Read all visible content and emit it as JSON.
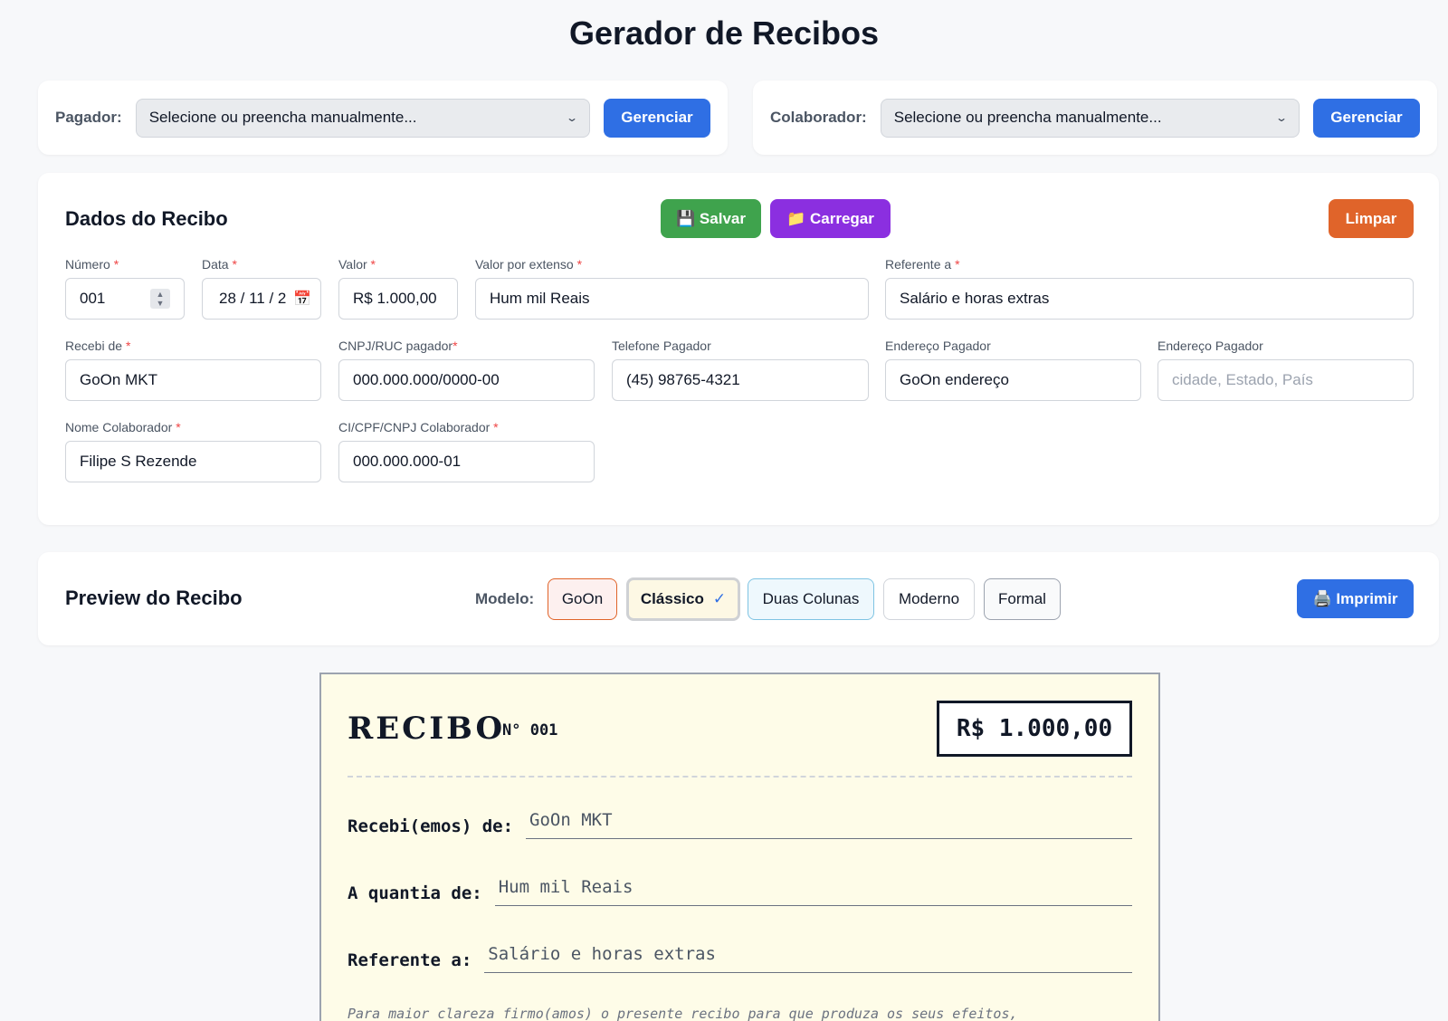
{
  "page_title": "Gerador de Recibos",
  "pagador": {
    "label": "Pagador:",
    "select_value": "Selecione ou preencha manualmente...",
    "button": "Gerenciar"
  },
  "colaborador": {
    "label": "Colaborador:",
    "select_value": "Selecione ou preencha manualmente...",
    "button": "Gerenciar"
  },
  "dados": {
    "title": "Dados do Recibo",
    "save_button": "💾 Salvar",
    "load_button": "📁 Carregar",
    "clear_button": "Limpar",
    "fields": {
      "numero": {
        "label": "Número",
        "value": "001"
      },
      "data": {
        "label": "Data",
        "value": "28 / 11 / 2"
      },
      "valor": {
        "label": "Valor",
        "value": "R$ 1.000,00"
      },
      "extenso": {
        "label": "Valor por extenso",
        "value": "Hum mil Reais"
      },
      "referente": {
        "label": "Referente a",
        "value": "Salário e horas extras"
      },
      "recebi": {
        "label": "Recebi de",
        "value": "GoOn MKT"
      },
      "cnpj_pagador": {
        "label": "CNPJ/RUC pagador",
        "value": "000.000.000/0000-00"
      },
      "telefone": {
        "label": "Telefone Pagador",
        "value": "(45) 98765-4321"
      },
      "endereco1": {
        "label": "Endereço Pagador",
        "value": "GoOn endereço"
      },
      "endereco2": {
        "label": "Endereço Pagador",
        "placeholder": "cidade, Estado, País"
      },
      "nome_colab": {
        "label": "Nome Colaborador",
        "value": "Filipe S Rezende"
      },
      "doc_colab": {
        "label": "CI/CPF/CNPJ Colaborador",
        "value": "000.000.000-01"
      }
    }
  },
  "preview": {
    "title": "Preview do Recibo",
    "model_label": "Modelo:",
    "models": [
      "GoOn",
      "Clássico",
      "Duas Colunas",
      "Moderno",
      "Formal"
    ],
    "selected_model": "Clássico",
    "selected_check": "✓",
    "print_button": "🖨️ Imprimir"
  },
  "receipt": {
    "title": "RECIBO",
    "number": "N° 001",
    "value": "R$ 1.000,00",
    "received_from_label": "Recebi(emos) de:",
    "received_from": "GoOn MKT",
    "amount_label": "A quantia de:",
    "amount": "Hum mil Reais",
    "reference_label": "Referente a:",
    "reference": "Salário e horas extras",
    "footer": "Para maior clareza firmo(amos) o presente recibo para que produza os seus efeitos,"
  },
  "colors": {
    "primary_blue": "#2f6fe4",
    "save_green": "#3fa34d",
    "load_purple": "#8b2fe0",
    "clear_orange": "#e0642a",
    "receipt_bg": "#fefce8"
  }
}
